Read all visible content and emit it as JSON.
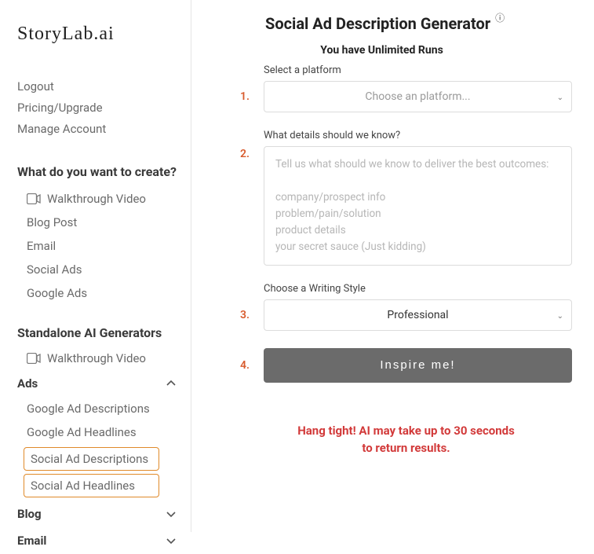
{
  "logo": "StoryLab.ai",
  "account_links": [
    "Logout",
    "Pricing/Upgrade",
    "Manage Account"
  ],
  "create": {
    "heading": "What do you want to create?",
    "items": [
      {
        "label": "Walkthrough Video",
        "icon": "video"
      },
      {
        "label": "Blog Post"
      },
      {
        "label": "Email"
      },
      {
        "label": "Social Ads"
      },
      {
        "label": "Google Ads"
      }
    ]
  },
  "standalone": {
    "heading": "Standalone AI Generators",
    "walkthrough": "Walkthrough Video",
    "groups": [
      {
        "name": "Ads",
        "expanded": true,
        "items": [
          {
            "label": "Google Ad Descriptions"
          },
          {
            "label": "Google Ad Headlines"
          },
          {
            "label": "Social Ad Descriptions",
            "highlight": true
          },
          {
            "label": "Social Ad Headlines",
            "highlight": true
          }
        ]
      },
      {
        "name": "Blog",
        "expanded": false,
        "items": []
      },
      {
        "name": "Email",
        "expanded": false,
        "items": []
      }
    ]
  },
  "page": {
    "title": "Social Ad Description Generator",
    "runs": "You have Unlimited Runs"
  },
  "form": {
    "step1": {
      "num": "1.",
      "label": "Select a platform",
      "placeholder": "Choose an platform..."
    },
    "step2": {
      "num": "2.",
      "label": "What details should we know?",
      "placeholder": "Tell us what should we know to deliver the best outcomes:\n\ncompany/prospect info\nproblem/pain/solution\nproduct details\nyour secret sauce (Just kidding)"
    },
    "step3": {
      "num": "3.",
      "label": "Choose a Writing Style",
      "value": "Professional"
    },
    "step4": {
      "num": "4.",
      "button": "Inspire me!"
    }
  },
  "wait": {
    "line1": "Hang tight! AI may take up to 30 seconds",
    "line2": "to return results."
  }
}
